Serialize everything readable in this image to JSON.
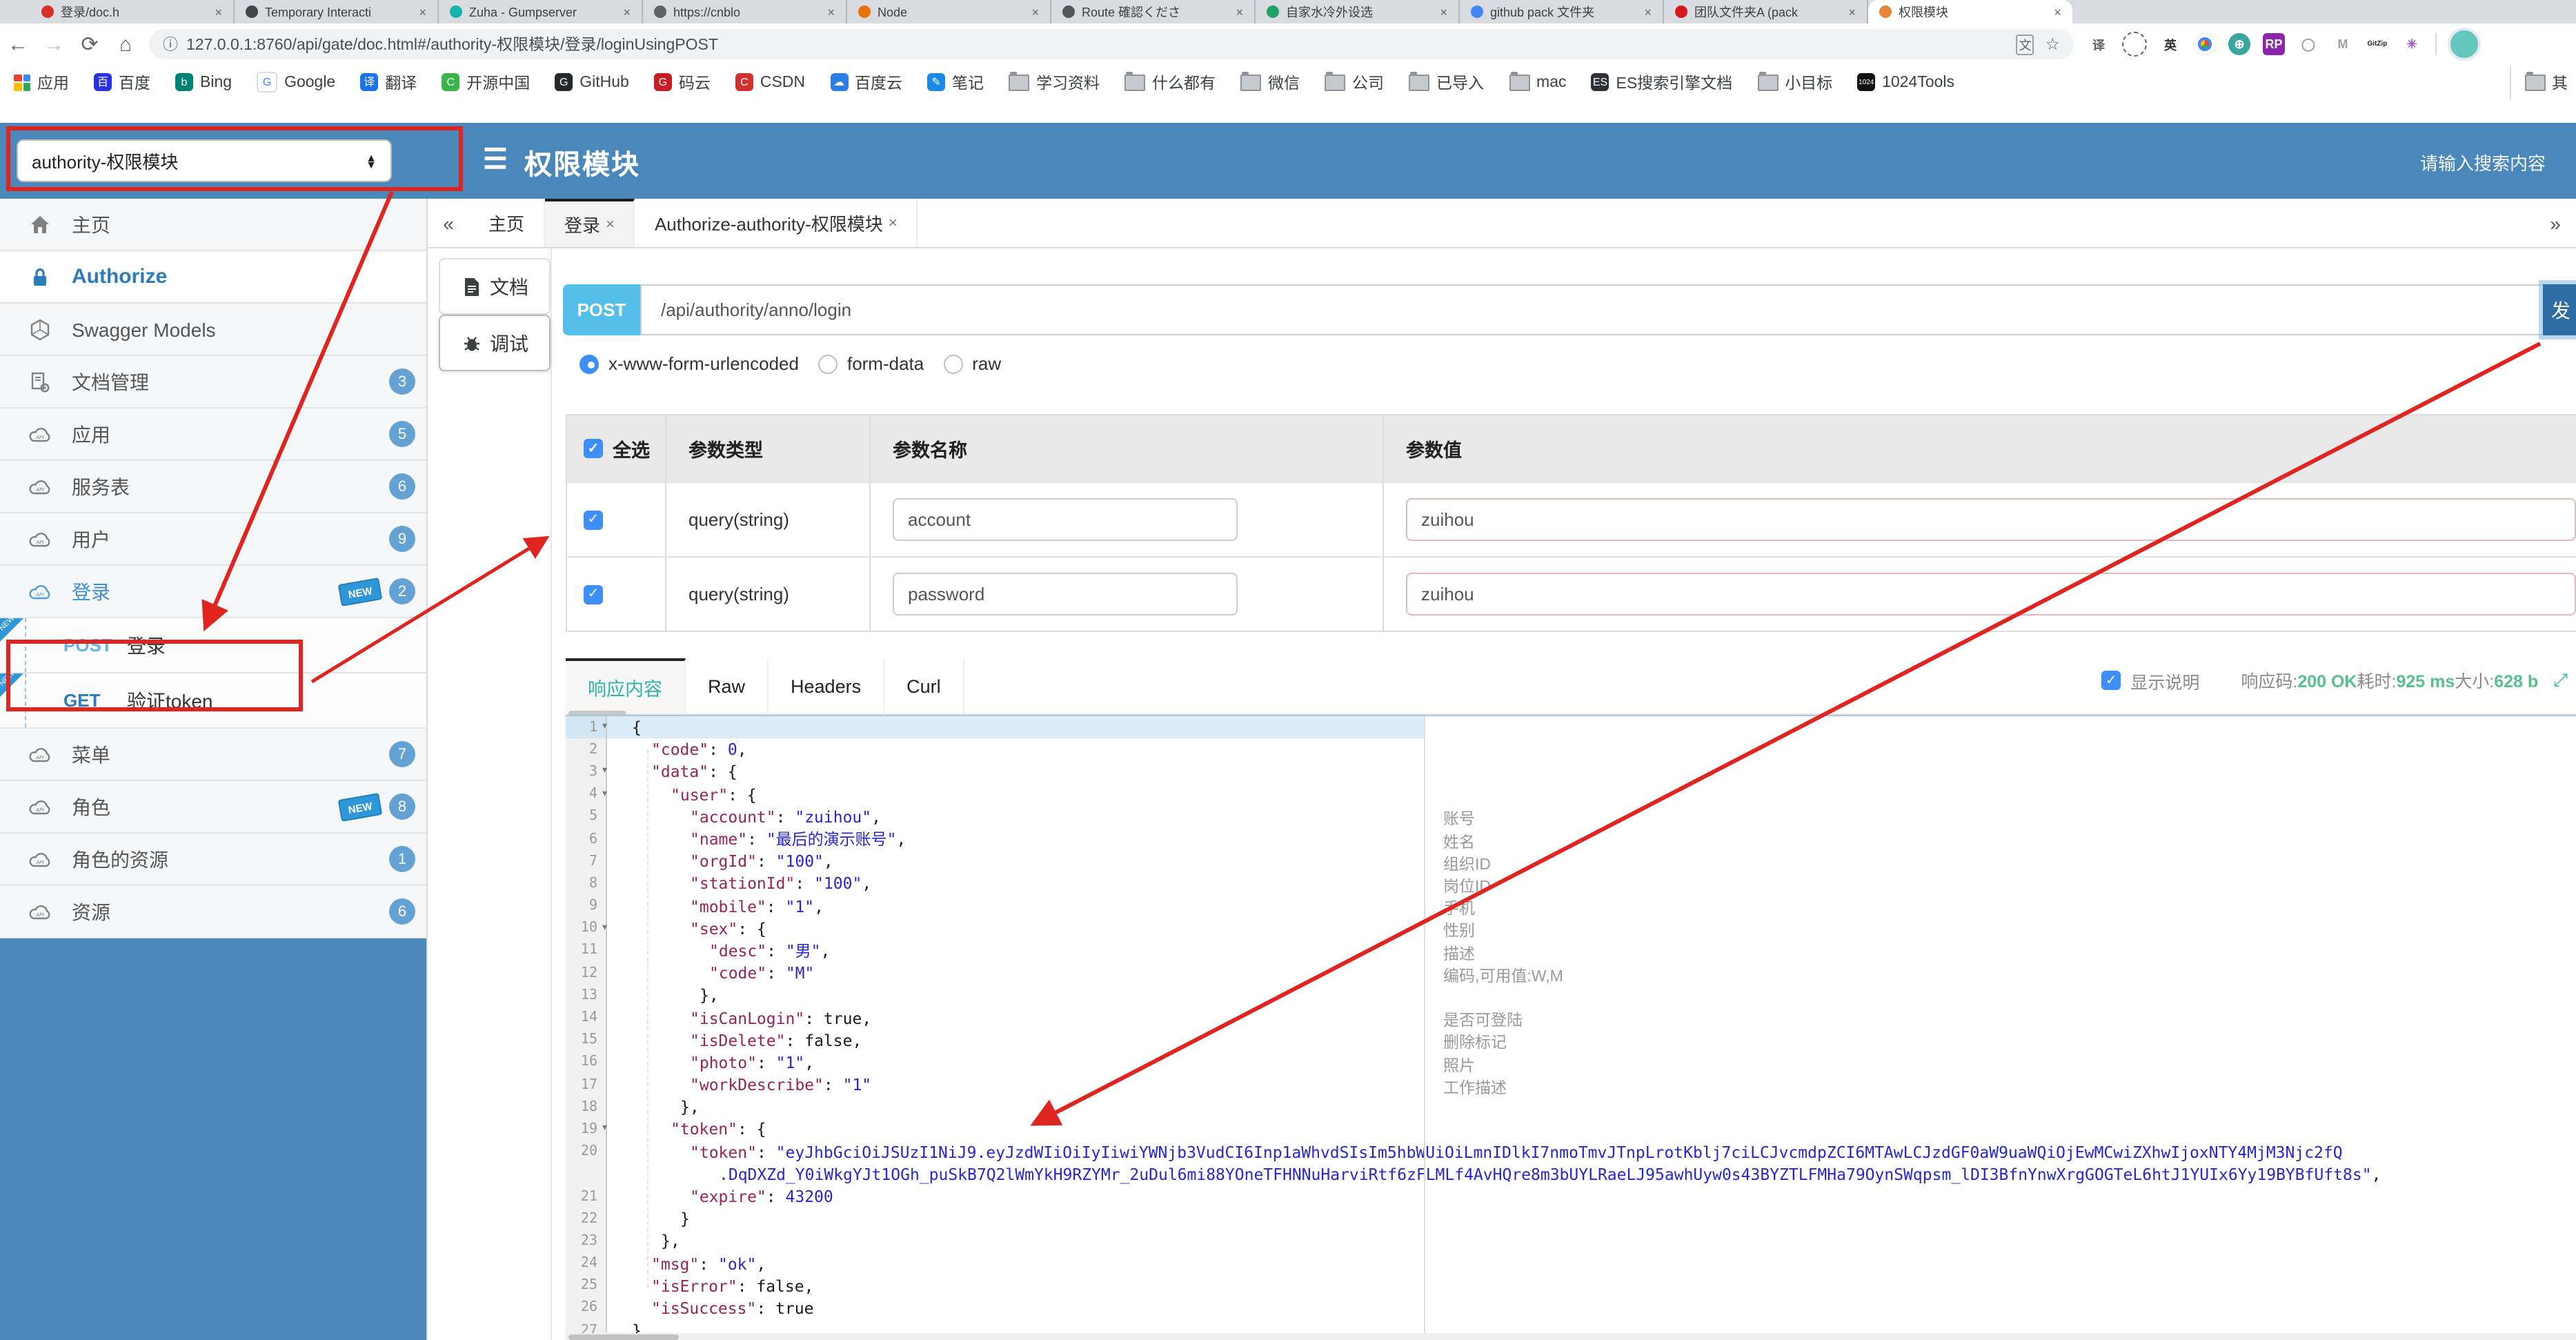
{
  "browser": {
    "tabs": [
      {
        "title": "登录/doc.h",
        "color": "#d93025",
        "active": false
      },
      {
        "title": "Temporary Interacti",
        "color": "#444444",
        "active": false
      },
      {
        "title": "Zuha - Gumpserver",
        "color": "#16b3ac",
        "active": false
      },
      {
        "title": "https://cnblo",
        "color": "#5f6368",
        "active": false
      },
      {
        "title": "Node",
        "color": "#e8710a",
        "active": false
      },
      {
        "title": "Route 確認くださ",
        "color": "#555555",
        "active": false
      },
      {
        "title": "自家水冷外设选",
        "color": "#21a366",
        "active": false
      },
      {
        "title": "github pack 文件夹",
        "color": "#4285f4",
        "active": false
      },
      {
        "title": "团队文件夹A (pack",
        "color": "#d7191c",
        "active": false
      },
      {
        "title": "权限模块",
        "color": "#e8833a",
        "active": true
      }
    ],
    "toolbar": {
      "url": "127.0.0.1:8760/api/gate/doc.html#/authority-权限模块/登录/loginUsingPOST",
      "back": "←",
      "forward": "→",
      "reload": "⟳",
      "home": "⌂",
      "translate_glyph": "文",
      "star": "☆"
    },
    "extensions": [
      {
        "name": "translate-ext-icon",
        "glyph": "译",
        "fg": "#5f6368",
        "bg": ""
      },
      {
        "name": "capture-icon",
        "glyph": "◌",
        "fg": "#333333",
        "bg": ""
      },
      {
        "name": "en-dict-icon",
        "glyph": "英",
        "fg": "#333333",
        "bg": ""
      },
      {
        "name": "chrome-icon",
        "glyph": "",
        "fg": "#fff",
        "bg": "conic"
      },
      {
        "name": "globe-icon",
        "glyph": "⊕",
        "fg": "#ffffff",
        "bg": "#3aa6a0"
      },
      {
        "name": "rp-icon",
        "glyph": "RP",
        "fg": "#ffffff",
        "bg": "#8e24aa"
      },
      {
        "name": "ring-icon",
        "glyph": "◯",
        "fg": "#9aa0a6",
        "bg": ""
      },
      {
        "name": "m-shield-icon",
        "glyph": "M",
        "fg": "#9aa0a6",
        "bg": ""
      },
      {
        "name": "gitzip-icon",
        "glyph": "GitZip",
        "fg": "#222222",
        "bg": ""
      },
      {
        "name": "asterisk-icon",
        "glyph": "✳",
        "fg": "#a156c9",
        "bg": ""
      }
    ],
    "bookmarks": [
      {
        "label": "应用",
        "kind": "grid"
      },
      {
        "label": "百度",
        "kind": "site",
        "bg": "#2932e1",
        "glyph": "百"
      },
      {
        "label": "Bing",
        "kind": "site",
        "bg": "#008373",
        "glyph": "b"
      },
      {
        "label": "Google",
        "kind": "site",
        "bg": "#ffffff",
        "glyph": "G",
        "fg": "#4285f4",
        "border": "#dadce0"
      },
      {
        "label": "翻译",
        "kind": "site",
        "bg": "#1a73e8",
        "glyph": "译"
      },
      {
        "label": "开源中国",
        "kind": "site",
        "bg": "#3ab54a",
        "glyph": "C"
      },
      {
        "label": "GitHub",
        "kind": "site",
        "bg": "#24292e",
        "glyph": "G"
      },
      {
        "label": "码云",
        "kind": "site",
        "bg": "#c71d23",
        "glyph": "G"
      },
      {
        "label": "CSDN",
        "kind": "site",
        "bg": "#d32f2f",
        "glyph": "C"
      },
      {
        "label": "百度云",
        "kind": "site",
        "bg": "#2b7de1",
        "glyph": "☁"
      },
      {
        "label": "笔记",
        "kind": "site",
        "bg": "#1e88e5",
        "glyph": "✎"
      },
      {
        "label": "学习资料",
        "kind": "folder"
      },
      {
        "label": "什么都有",
        "kind": "folder"
      },
      {
        "label": "微信",
        "kind": "folder"
      },
      {
        "label": "公司",
        "kind": "folder"
      },
      {
        "label": "已导入",
        "kind": "folder"
      },
      {
        "label": "mac",
        "kind": "folder"
      },
      {
        "label": "ES搜索引擎文档",
        "kind": "site",
        "bg": "#2f3136",
        "glyph": "ES"
      },
      {
        "label": "小目标",
        "kind": "folder"
      },
      {
        "label": "1024Tools",
        "kind": "site",
        "bg": "#111111",
        "glyph": "1024"
      }
    ],
    "bookmarks_overflow": "其"
  },
  "app": {
    "header": {
      "service_select_value": "authority-权限模块",
      "title": "权限模块",
      "search_placeholder": "请输入搜索内容"
    },
    "sidebar": [
      {
        "label": "主页",
        "icon": "home",
        "type": "item"
      },
      {
        "label": "Authorize",
        "icon": "lock",
        "type": "auth"
      },
      {
        "label": "Swagger Models",
        "icon": "hexagon",
        "type": "item"
      },
      {
        "label": "文档管理",
        "icon": "docgear",
        "type": "item",
        "badge": "3"
      },
      {
        "label": "应用",
        "icon": "cloud",
        "type": "item",
        "badge": "5"
      },
      {
        "label": "服务表",
        "icon": "cloud",
        "type": "item",
        "badge": "6"
      },
      {
        "label": "用户",
        "icon": "cloud",
        "type": "item",
        "badge": "9"
      },
      {
        "label": "登录",
        "icon": "cloud",
        "type": "item",
        "badge": "2",
        "new": true,
        "active": true
      },
      {
        "label": "登录",
        "method": "POST",
        "type": "child",
        "new": true
      },
      {
        "label": "验证token",
        "method": "GET",
        "type": "child",
        "new": true
      },
      {
        "label": "菜单",
        "icon": "cloud",
        "type": "item",
        "badge": "7"
      },
      {
        "label": "角色",
        "icon": "cloud",
        "type": "item",
        "badge": "8",
        "new": true
      },
      {
        "label": "角色的资源",
        "icon": "cloud",
        "type": "item",
        "badge": "1"
      },
      {
        "label": "资源",
        "icon": "cloud",
        "type": "item",
        "badge": "6"
      }
    ],
    "method_colors": {
      "POST": "#61b3e6",
      "GET": "#2b7cb9"
    },
    "tabbar": {
      "left_chevron": "«",
      "right_chevron": "»",
      "tabs": [
        {
          "label": "主页",
          "closable": false,
          "active": false
        },
        {
          "label": "登录",
          "closable": true,
          "active": true
        },
        {
          "label": "Authorize-authority-权限模块",
          "closable": true,
          "active": false
        }
      ],
      "close_glyph": "×"
    },
    "doc_tabs": [
      {
        "label": "文档",
        "icon": "doc",
        "active": false
      },
      {
        "label": "调试",
        "icon": "bug",
        "active": true
      }
    ],
    "request": {
      "method": "POST",
      "url": "/api/authority/anno/login",
      "send_label": "发送",
      "content_types": [
        "x-www-form-urlencoded",
        "form-data",
        "raw"
      ],
      "selected_type": 0
    },
    "params": {
      "headers": {
        "all": "全选",
        "type": "参数类型",
        "name": "参数名称",
        "value": "参数值"
      },
      "rows": [
        {
          "checked": true,
          "type": "query(string)",
          "name": "account",
          "value": "zuihou"
        },
        {
          "checked": true,
          "type": "query(string)",
          "name": "password",
          "value": "zuihou"
        }
      ]
    },
    "response": {
      "tabs": [
        "响应内容",
        "Raw",
        "Headers",
        "Curl"
      ],
      "active_tab": 0,
      "show_desc_label": "显示说明",
      "meta": [
        {
          "label": "响应码:",
          "value": "200 OK"
        },
        {
          "label": "耗时:",
          "value": "925 ms"
        },
        {
          "label": "大小:",
          "value": "628 b"
        }
      ]
    },
    "code": {
      "lines": [
        {
          "n": "1",
          "ind": 0,
          "fold": true,
          "hl": true,
          "seg": [
            [
              "{",
              "p"
            ]
          ]
        },
        {
          "n": "2",
          "ind": 1,
          "seg": [
            [
              "\"code\"",
              "k"
            ],
            [
              ": ",
              "p"
            ],
            [
              "0",
              "n"
            ],
            [
              ",",
              "p"
            ]
          ]
        },
        {
          "n": "3",
          "ind": 1,
          "fold": true,
          "seg": [
            [
              "\"data\"",
              "k"
            ],
            [
              ": {",
              "p"
            ]
          ]
        },
        {
          "n": "4",
          "ind": 2,
          "fold": true,
          "seg": [
            [
              "\"user\"",
              "k"
            ],
            [
              ": {",
              "p"
            ]
          ]
        },
        {
          "n": "5",
          "ind": 3,
          "seg": [
            [
              "\"account\"",
              "k"
            ],
            [
              ": ",
              "p"
            ],
            [
              "\"zuihou\"",
              "s"
            ],
            [
              ",",
              "p"
            ]
          ]
        },
        {
          "n": "6",
          "ind": 3,
          "seg": [
            [
              "\"name\"",
              "k"
            ],
            [
              ": ",
              "p"
            ],
            [
              "\"最后的演示账号\"",
              "s"
            ],
            [
              ",",
              "p"
            ]
          ]
        },
        {
          "n": "7",
          "ind": 3,
          "seg": [
            [
              "\"orgId\"",
              "k"
            ],
            [
              ": ",
              "p"
            ],
            [
              "\"100\"",
              "s"
            ],
            [
              ",",
              "p"
            ]
          ]
        },
        {
          "n": "8",
          "ind": 3,
          "seg": [
            [
              "\"stationId\"",
              "k"
            ],
            [
              ": ",
              "p"
            ],
            [
              "\"100\"",
              "s"
            ],
            [
              ",",
              "p"
            ]
          ]
        },
        {
          "n": "9",
          "ind": 3,
          "seg": [
            [
              "\"mobile\"",
              "k"
            ],
            [
              ": ",
              "p"
            ],
            [
              "\"1\"",
              "s"
            ],
            [
              ",",
              "p"
            ]
          ]
        },
        {
          "n": "10",
          "ind": 3,
          "fold": true,
          "seg": [
            [
              "\"sex\"",
              "k"
            ],
            [
              ": {",
              "p"
            ]
          ]
        },
        {
          "n": "11",
          "ind": 4,
          "seg": [
            [
              "\"desc\"",
              "k"
            ],
            [
              ": ",
              "p"
            ],
            [
              "\"男\"",
              "s"
            ],
            [
              ",",
              "p"
            ]
          ]
        },
        {
          "n": "12",
          "ind": 4,
          "seg": [
            [
              "\"code\"",
              "k"
            ],
            [
              ": ",
              "p"
            ],
            [
              "\"M\"",
              "s"
            ]
          ]
        },
        {
          "n": "13",
          "ind": 3,
          "closer": true,
          "seg": [
            [
              "},",
              "p"
            ]
          ]
        },
        {
          "n": "14",
          "ind": 3,
          "seg": [
            [
              "\"isCanLogin\"",
              "k"
            ],
            [
              ": ",
              "p"
            ],
            [
              "true",
              "b"
            ],
            [
              ",",
              "p"
            ]
          ]
        },
        {
          "n": "15",
          "ind": 3,
          "seg": [
            [
              "\"isDelete\"",
              "k"
            ],
            [
              ": ",
              "p"
            ],
            [
              "false",
              "b"
            ],
            [
              ",",
              "p"
            ]
          ]
        },
        {
          "n": "16",
          "ind": 3,
          "seg": [
            [
              "\"photo\"",
              "k"
            ],
            [
              ": ",
              "p"
            ],
            [
              "\"1\"",
              "s"
            ],
            [
              ",",
              "p"
            ]
          ]
        },
        {
          "n": "17",
          "ind": 3,
          "seg": [
            [
              "\"workDescribe\"",
              "k"
            ],
            [
              ": ",
              "p"
            ],
            [
              "\"1\"",
              "s"
            ]
          ]
        },
        {
          "n": "18",
          "ind": 2,
          "closer": true,
          "seg": [
            [
              "},",
              "p"
            ]
          ]
        },
        {
          "n": "19",
          "ind": 2,
          "fold": true,
          "seg": [
            [
              "\"token\"",
              "k"
            ],
            [
              ": {",
              "p"
            ]
          ]
        },
        {
          "n": "20",
          "ind": 3,
          "seg": [
            [
              "\"token\"",
              "k"
            ],
            [
              ": ",
              "p"
            ],
            [
              "\"eyJhbGciOiJSUzI1NiJ9.eyJzdWIiOiIyIiwiYWNjb3VudCI6Inp1aWhvdSIsIm5hbWUiOiLmnIDlkI7nmoTmvJTnpLrotKblj7ciLCJvcmdpZCI6MTAwLCJzdGF0aW9uaWQiOjEwMCwiZXhwIjoxNTY4MjM3Njc2fQ",
              "s"
            ]
          ]
        },
        {
          "n": "",
          "ind": 3,
          "extra": 21,
          "seg": [
            [
              ".DqDXZd_Y0iWkgYJt1OGh_puSkB7Q2lWmYkH9RZYMr_2uDul6mi88YOneTFHNNuHarviRtf6zFLMLf4AvHQre8m3bUYLRaeLJ95awhUyw0s43BYZTLFMHa79OynSWqpsm_lDI3BfnYnwXrgGOGTeL6htJ1YUIx6Yy19BYBfUft8s\"",
              "s"
            ],
            [
              ",",
              "p"
            ]
          ]
        },
        {
          "n": "21",
          "ind": 3,
          "seg": [
            [
              "\"expire\"",
              "k"
            ],
            [
              ": ",
              "p"
            ],
            [
              "43200",
              "n"
            ]
          ]
        },
        {
          "n": "22",
          "ind": 2,
          "closer": true,
          "seg": [
            [
              "}",
              "p"
            ]
          ]
        },
        {
          "n": "23",
          "ind": 1,
          "closer": true,
          "seg": [
            [
              "},",
              "p"
            ]
          ]
        },
        {
          "n": "24",
          "ind": 1,
          "seg": [
            [
              "\"msg\"",
              "k"
            ],
            [
              ": ",
              "p"
            ],
            [
              "\"ok\"",
              "s"
            ],
            [
              ",",
              "p"
            ]
          ]
        },
        {
          "n": "25",
          "ind": 1,
          "seg": [
            [
              "\"isError\"",
              "k"
            ],
            [
              ": ",
              "p"
            ],
            [
              "false",
              "b"
            ],
            [
              ",",
              "p"
            ]
          ]
        },
        {
          "n": "26",
          "ind": 1,
          "seg": [
            [
              "\"isSuccess\"",
              "k"
            ],
            [
              ": ",
              "p"
            ],
            [
              "true",
              "b"
            ]
          ]
        },
        {
          "n": "27",
          "ind": 0,
          "seg": [
            [
              "}",
              "p"
            ]
          ]
        }
      ],
      "annotations": [
        {
          "row": 5,
          "text": "账号"
        },
        {
          "row": 6,
          "text": "姓名"
        },
        {
          "row": 7,
          "text": "组织ID"
        },
        {
          "row": 8,
          "text": "岗位ID"
        },
        {
          "row": 9,
          "text": "手机"
        },
        {
          "row": 10,
          "text": "性别"
        },
        {
          "row": 11,
          "text": "描述"
        },
        {
          "row": 12,
          "text": "编码,可用值:W,M"
        },
        {
          "row": 14,
          "text": "是否可登陆"
        },
        {
          "row": 15,
          "text": "删除标记"
        },
        {
          "row": 16,
          "text": "照片"
        },
        {
          "row": 17,
          "text": "工作描述"
        }
      ]
    }
  },
  "colors": {
    "header_blue": "#4a87ba",
    "post_chip": "#54c0e9",
    "send_btn": "#2e6da4",
    "check_blue": "#3d8ef5",
    "badge_blue": "#64a2d4",
    "active_resp_tab": "#2cb5a0",
    "meta_green": "#57c08c",
    "code_key": "#96245c",
    "code_value": "#2727cc",
    "annotation_red": "#e02420"
  }
}
